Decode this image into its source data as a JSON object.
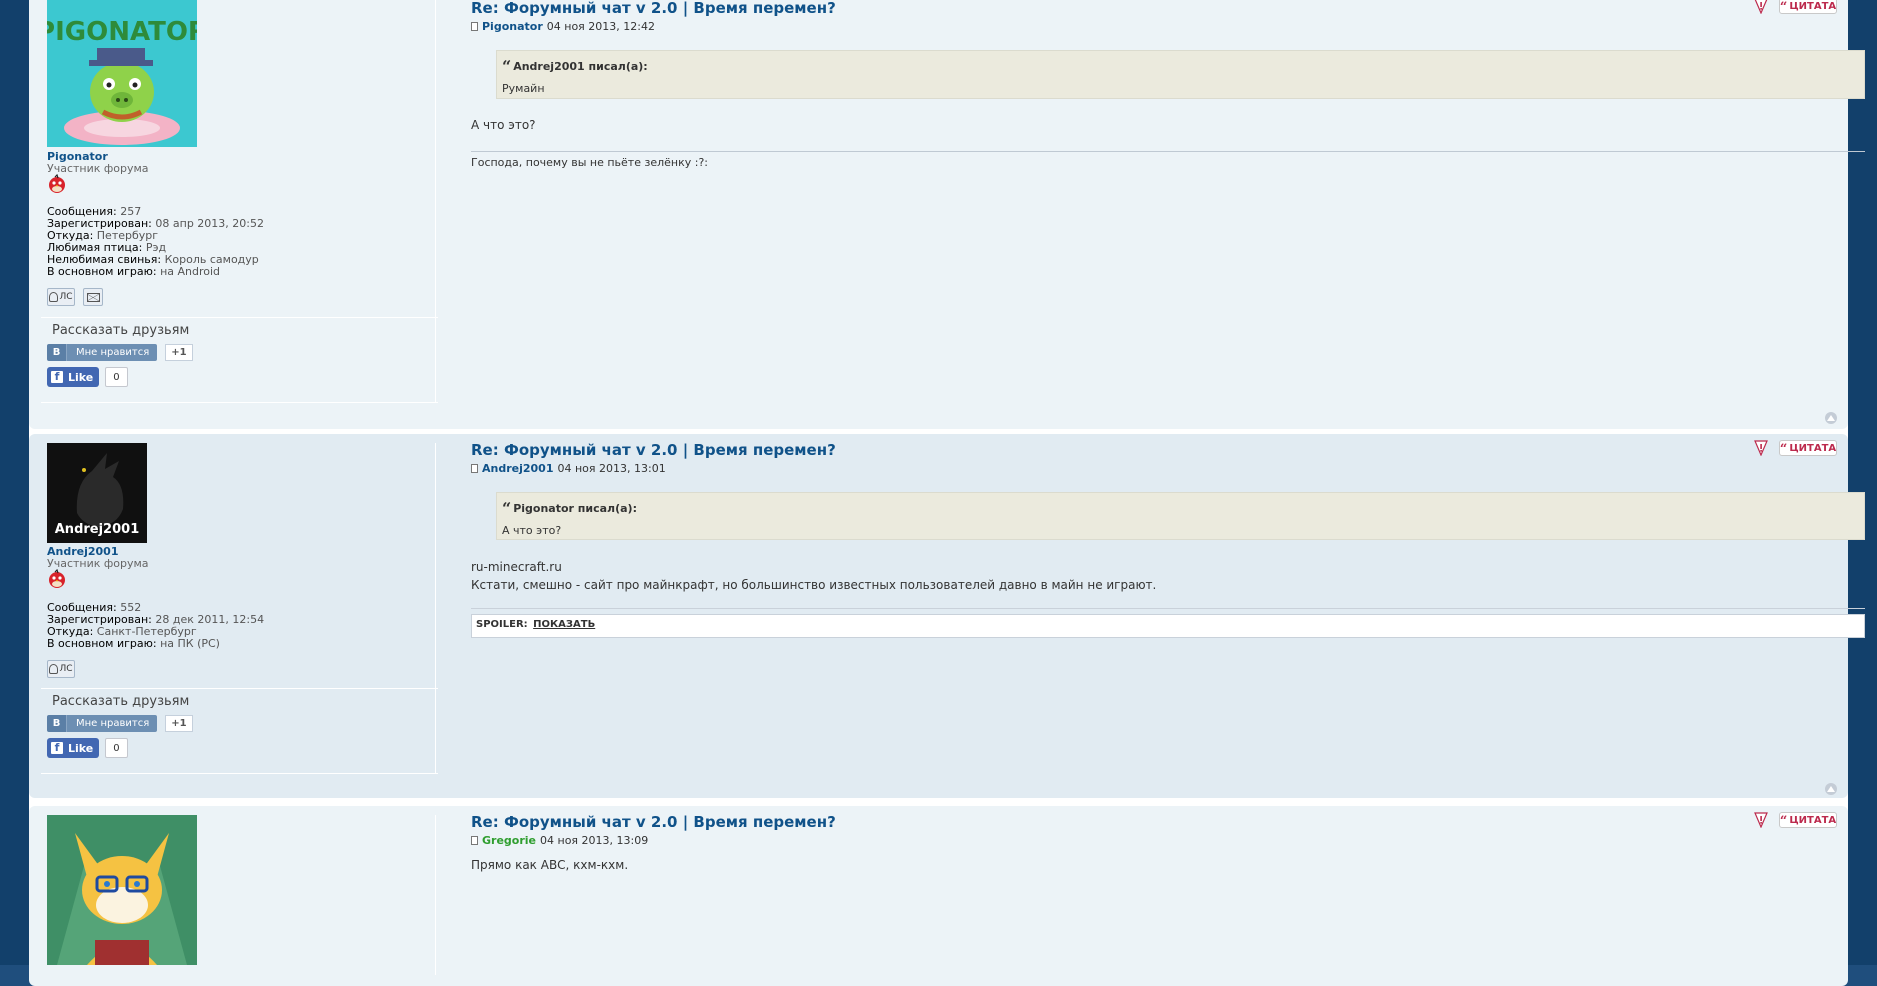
{
  "posts": [
    {
      "title": "Re: Форумный чат v 2.0 | Время перемен?",
      "author": "Pigonator",
      "date": "04 ноя 2013, 12:42",
      "avatar_text": "PIGONATOR",
      "rank": "Участник форума",
      "profile_fields": [
        {
          "label": "Сообщения:",
          "value": "257"
        },
        {
          "label": "Зарегистрирован:",
          "value": "08 апр 2013, 20:52"
        },
        {
          "label": "Откуда:",
          "value": "Петербург"
        },
        {
          "label": "Любимая птица:",
          "value": "Рэд"
        },
        {
          "label": "Нелюбимая свинья:",
          "value": "Король самодур"
        },
        {
          "label": "В основном играю:",
          "value": "на Android"
        }
      ],
      "quote": {
        "header": "Andrej2001 писал(а):",
        "text": "Румайн"
      },
      "text_lines": [
        "А что это?"
      ],
      "signature": "Господа, почему вы не пьёте зелёнку :?:"
    },
    {
      "title": "Re: Форумный чат v 2.0 | Время перемен?",
      "author": "Andrej2001",
      "date": "04 ноя 2013, 13:01",
      "avatar_text": "Andrej2001",
      "rank": "Участник форума",
      "profile_fields": [
        {
          "label": "Сообщения:",
          "value": "552"
        },
        {
          "label": "Зарегистрирован:",
          "value": "28 дек 2011, 12:54"
        },
        {
          "label": "Откуда:",
          "value": "Санкт-Петербург"
        },
        {
          "label": "В основном играю:",
          "value": "на ПК (PC)"
        }
      ],
      "quote": {
        "header": "Pigonator писал(а):",
        "text": "А что это?"
      },
      "text_lines": [
        "ru-minecraft.ru",
        "Кстати, смешно - сайт про майнкрафт, но большинство известных пользователей давно в майн не играют."
      ],
      "spoiler": {
        "label": "SPOILER:",
        "link": "ПОКАЗАТЬ"
      }
    },
    {
      "title": "Re: Форумный чат v 2.0 | Время перемен?",
      "author": "Gregorie",
      "date": "04 ноя 2013, 13:09",
      "text_lines": [
        "Прямо как АВС, кхм-кхм."
      ]
    }
  ],
  "share": {
    "title": "Рассказать друзьям",
    "vk_icon": "В",
    "vk_label": "Мне нравится",
    "vk_count": "+1",
    "fb_icon": "f",
    "fb_label": "Like",
    "fb_count": "0"
  },
  "buttons": {
    "quote_label": "ЦИТАТА",
    "pm_label": "ЛС"
  },
  "colors": {
    "link": "#105289",
    "post_bg1": "#ecf3f7",
    "post_bg2": "#e1ebf2",
    "quote_bg": "#ebeadd",
    "quote_button": "#bc2a4d",
    "moderator_name": "#2f9e2f"
  },
  "icons": [
    "post-icon",
    "report-icon",
    "quote-icon",
    "pm-icon",
    "email-icon",
    "back-to-top-icon",
    "rank-bird-icon"
  ]
}
